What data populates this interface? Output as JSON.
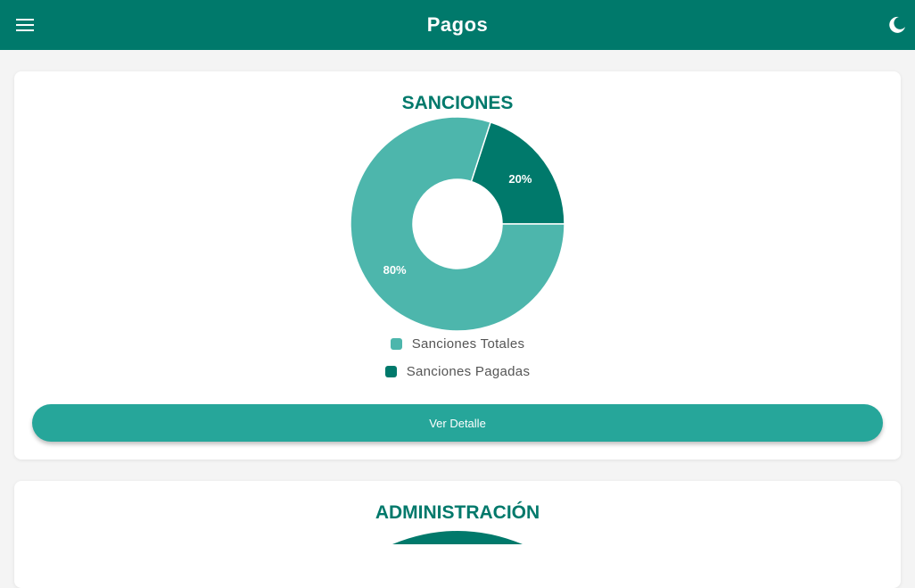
{
  "header": {
    "title": "Pagos",
    "menu_icon": "menu-icon",
    "theme_icon": "moon-icon"
  },
  "colors": {
    "primary": "#00796b",
    "secondary": "#4db6ac",
    "button": "#26a69a"
  },
  "sanciones": {
    "title": "SANCIONES",
    "button_label": "Ver Detalle",
    "legend": [
      "Sanciones Totales",
      "Sanciones Pagadas"
    ],
    "labels": [
      "80%",
      "20%"
    ]
  },
  "administracion": {
    "title": "ADMINISTRACIÓN"
  },
  "chart_data": [
    {
      "type": "pie",
      "title": "SANCIONES",
      "categories": [
        "Sanciones Totales",
        "Sanciones Pagadas"
      ],
      "values": [
        80,
        20
      ],
      "colors": [
        "#4db6ac",
        "#00796b"
      ],
      "legend": "bottom"
    }
  ]
}
